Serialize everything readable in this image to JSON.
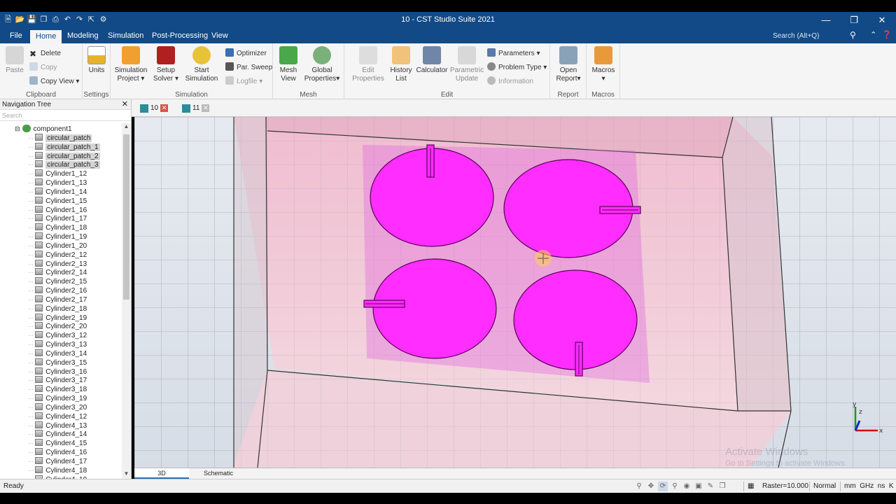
{
  "window": {
    "title": "10 - CST Studio Suite 2021"
  },
  "quick_access": [
    "new-icon",
    "open-icon",
    "save-icon",
    "save-all-icon",
    "print-icon",
    "undo-icon",
    "redo-icon",
    "pointer-icon",
    "options-icon"
  ],
  "menu": {
    "items": [
      "File",
      "Home",
      "Modeling",
      "Simulation",
      "Post-Processing",
      "View"
    ],
    "active": "Home",
    "search_placeholder": "Search (Alt+Q)"
  },
  "ribbon": {
    "clipboard": {
      "label": "Clipboard",
      "paste": "Paste",
      "delete": "Delete",
      "copy": "Copy",
      "copy_view": "Copy View"
    },
    "settings": {
      "label": "Settings",
      "units": "Units"
    },
    "simulation": {
      "label": "Simulation",
      "sim_project_1": "Simulation",
      "sim_project_2": "Project",
      "setup_1": "Setup",
      "setup_2": "Solver",
      "start_1": "Start",
      "start_2": "Simulation",
      "optimizer": "Optimizer",
      "par_sweep": "Par. Sweep",
      "logfile": "Logfile"
    },
    "mesh": {
      "label": "Mesh",
      "mesh_view_1": "Mesh",
      "mesh_view_2": "View",
      "global_1": "Global",
      "global_2": "Properties"
    },
    "edit": {
      "label": "Edit",
      "edit_props_1": "Edit",
      "edit_props_2": "Properties",
      "history_1": "History",
      "history_2": "List",
      "calculator": "Calculator",
      "param_1": "Parametric",
      "param_2": "Update",
      "parameters": "Parameters",
      "problem_type": "Problem Type",
      "information": "Information"
    },
    "report": {
      "label": "Report",
      "open_1": "Open",
      "open_2": "Report"
    },
    "macros": {
      "label": "Macros",
      "macros": "Macros"
    }
  },
  "nav": {
    "title": "Navigation Tree",
    "search_placeholder": "Search",
    "root": "component1",
    "items": [
      {
        "label": "circular_patch",
        "selected": true
      },
      {
        "label": "circular_patch_1",
        "selected": true
      },
      {
        "label": "circular_patch_2",
        "selected": true
      },
      {
        "label": "circular_patch_3",
        "selected": true
      },
      {
        "label": "Cylinder1_12"
      },
      {
        "label": "Cylinder1_13"
      },
      {
        "label": "Cylinder1_14"
      },
      {
        "label": "Cylinder1_15"
      },
      {
        "label": "Cylinder1_16"
      },
      {
        "label": "Cylinder1_17"
      },
      {
        "label": "Cylinder1_18"
      },
      {
        "label": "Cylinder1_19"
      },
      {
        "label": "Cylinder1_20"
      },
      {
        "label": "Cylinder2_12"
      },
      {
        "label": "Cylinder2_13"
      },
      {
        "label": "Cylinder2_14"
      },
      {
        "label": "Cylinder2_15"
      },
      {
        "label": "Cylinder2_16"
      },
      {
        "label": "Cylinder2_17"
      },
      {
        "label": "Cylinder2_18"
      },
      {
        "label": "Cylinder2_19"
      },
      {
        "label": "Cylinder2_20"
      },
      {
        "label": "Cylinder3_12"
      },
      {
        "label": "Cylinder3_13"
      },
      {
        "label": "Cylinder3_14"
      },
      {
        "label": "Cylinder3_15"
      },
      {
        "label": "Cylinder3_16"
      },
      {
        "label": "Cylinder3_17"
      },
      {
        "label": "Cylinder3_18"
      },
      {
        "label": "Cylinder3_19"
      },
      {
        "label": "Cylinder3_20"
      },
      {
        "label": "Cylinder4_12"
      },
      {
        "label": "Cylinder4_13"
      },
      {
        "label": "Cylinder4_14"
      },
      {
        "label": "Cylinder4_15"
      },
      {
        "label": "Cylinder4_16"
      },
      {
        "label": "Cylinder4_17"
      },
      {
        "label": "Cylinder4_18"
      },
      {
        "label": "Cylinder4_19"
      }
    ]
  },
  "doc_tabs": [
    {
      "label": "10"
    },
    {
      "label": "11"
    }
  ],
  "view_tabs": [
    "3D",
    "Schematic"
  ],
  "status": {
    "ready": "Ready",
    "raster": "Raster=10.000",
    "mode": "Normal",
    "units": "mm  GHz  ns  K"
  },
  "watermark": {
    "line1": "Activate Windows",
    "line2": "Go to Settings to activate Windows."
  },
  "colors": {
    "accent": "#114a86",
    "patch": "#ff2dff",
    "substrate": "#f4a9c8"
  }
}
